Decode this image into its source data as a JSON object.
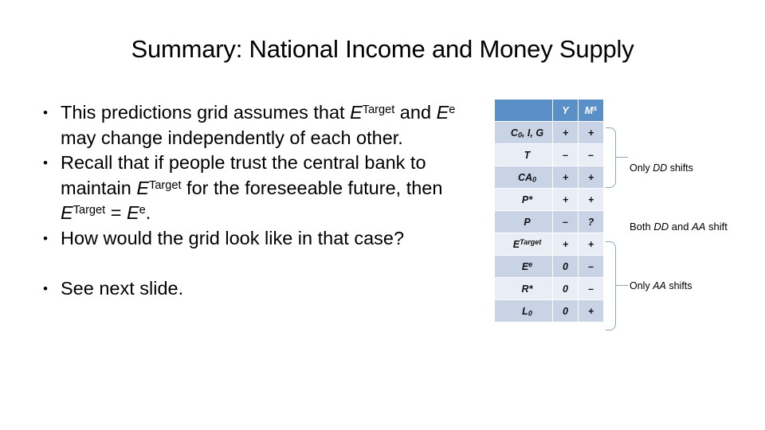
{
  "slide": {
    "title": "Summary: National Income and Money Supply"
  },
  "bullets": [
    {
      "marker": "•",
      "segments": [
        {
          "text": "This predictions grid assumes that ",
          "style": "plain"
        },
        {
          "text": "E",
          "style": "italic"
        },
        {
          "text": "Target",
          "style": "sup"
        },
        {
          "text": " and ",
          "style": "plain"
        },
        {
          "text": "E",
          "style": "italic"
        },
        {
          "text": "e",
          "style": "sup"
        },
        {
          "text": "  may change independently of each other.",
          "style": "plain"
        }
      ]
    },
    {
      "marker": "•",
      "segments": [
        {
          "text": "Recall that if people trust the central bank to maintain ",
          "style": "plain"
        },
        {
          "text": "E",
          "style": "italic"
        },
        {
          "text": "Target",
          "style": "sup"
        },
        {
          "text": " for the foreseeable future, then ",
          "style": "plain"
        },
        {
          "text": "E",
          "style": "italic"
        },
        {
          "text": "Target",
          "style": "sup"
        },
        {
          "text": " = ",
          "style": "plain"
        },
        {
          "text": "E",
          "style": "italic"
        },
        {
          "text": "e",
          "style": "sup"
        },
        {
          "text": ".",
          "style": "plain"
        }
      ]
    },
    {
      "marker": "•",
      "segments": [
        {
          "text": "How would the grid look like in that case?",
          "style": "plain"
        }
      ]
    },
    {
      "marker": "•",
      "segments": [
        {
          "text": "See next slide.",
          "style": "plain"
        }
      ]
    }
  ],
  "table": {
    "headers": {
      "corner": "",
      "col1": "Y",
      "col2_base": "M",
      "col2_sup": "s"
    },
    "rows": [
      {
        "label_html": "C<sub>0</sub>, I, G",
        "label_text": "C0, I, G",
        "y": "+",
        "ms": "+",
        "band": "a"
      },
      {
        "label_html": "T",
        "label_text": "T",
        "y": "–",
        "ms": "–",
        "band": "b"
      },
      {
        "label_html": "CA<sub>0</sub>",
        "label_text": "CA0",
        "y": "+",
        "ms": "+",
        "band": "a"
      },
      {
        "label_html": "P*",
        "label_text": "P*",
        "y": "+",
        "ms": "+",
        "band": "b"
      },
      {
        "label_html": "P",
        "label_text": "P",
        "y": "–",
        "ms": "?",
        "band": "a"
      },
      {
        "label_html": "E<sup>Target</sup>",
        "label_text": "ETarget",
        "y": "+",
        "ms": "+",
        "band": "b"
      },
      {
        "label_html": "E<sup>e</sup>",
        "label_text": "Ee",
        "y": "0",
        "ms": "–",
        "band": "a"
      },
      {
        "label_html": "R*",
        "label_text": "R*",
        "y": "0",
        "ms": "–",
        "band": "b"
      },
      {
        "label_html": "L<sub>0</sub>",
        "label_text": "L0",
        "y": "0",
        "ms": "+",
        "band": "a"
      }
    ]
  },
  "annotations": [
    {
      "id": "only-dd",
      "segments": [
        {
          "text": "Only ",
          "style": "plain"
        },
        {
          "text": "DD",
          "style": "italic"
        },
        {
          "text": " shifts",
          "style": "plain"
        }
      ]
    },
    {
      "id": "both-dd-aa",
      "segments": [
        {
          "text": "Both ",
          "style": "plain"
        },
        {
          "text": "DD",
          "style": "italic"
        },
        {
          "text": " and ",
          "style": "plain"
        },
        {
          "text": "AA",
          "style": "italic"
        },
        {
          "text": " shift",
          "style": "plain"
        }
      ]
    },
    {
      "id": "only-aa",
      "segments": [
        {
          "text": "Only ",
          "style": "plain"
        },
        {
          "text": "AA",
          "style": "italic"
        },
        {
          "text": " shifts",
          "style": "plain"
        }
      ]
    }
  ],
  "colors": {
    "header_blue": "#5b8fc7",
    "band_dark": "#c8d3e6",
    "band_light": "#e9eef6",
    "brace": "#8aa7c4",
    "text": "#000000"
  }
}
